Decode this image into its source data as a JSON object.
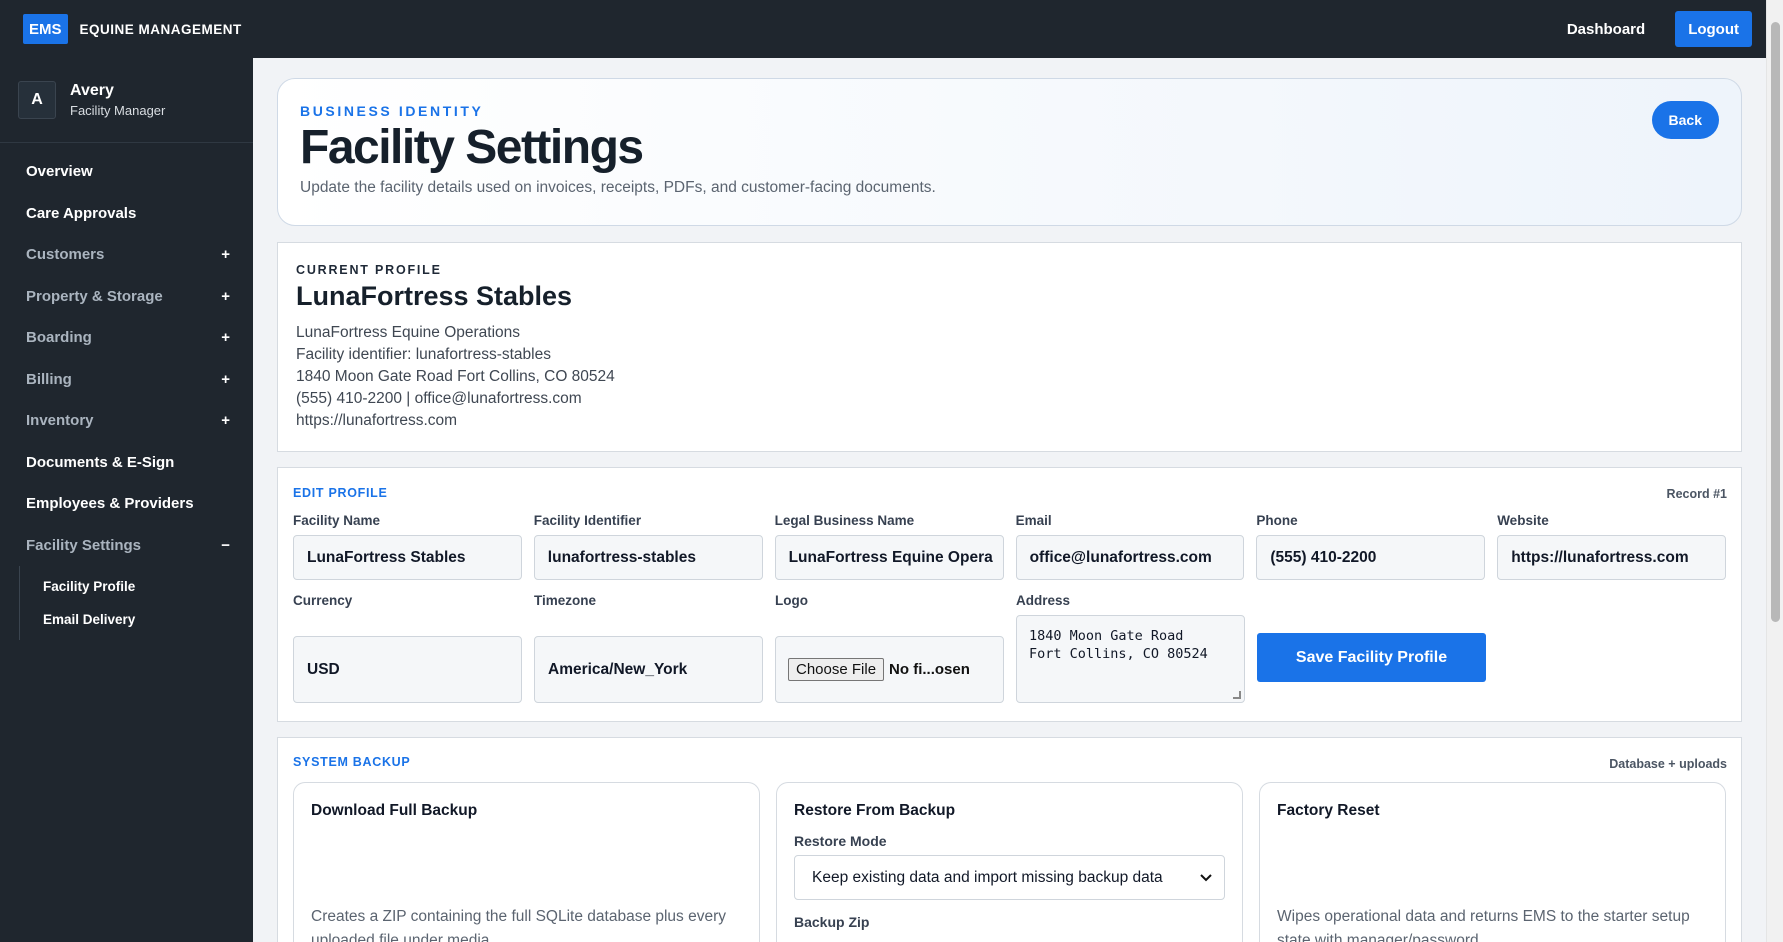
{
  "topbar": {
    "badge": "EMS",
    "brand": "EQUINE MANAGEMENT",
    "dashboard": "Dashboard",
    "logout": "Logout"
  },
  "user": {
    "initial": "A",
    "name": "Avery",
    "role": "Facility Manager"
  },
  "sidebar": {
    "items": [
      {
        "label": "Overview",
        "toggle": ""
      },
      {
        "label": "Care Approvals",
        "toggle": ""
      },
      {
        "label": "Customers",
        "toggle": "+"
      },
      {
        "label": "Property & Storage",
        "toggle": "+"
      },
      {
        "label": "Boarding",
        "toggle": "+"
      },
      {
        "label": "Billing",
        "toggle": "+"
      },
      {
        "label": "Inventory",
        "toggle": "+"
      },
      {
        "label": "Documents & E-Sign",
        "toggle": ""
      },
      {
        "label": "Employees & Providers",
        "toggle": ""
      },
      {
        "label": "Facility Settings",
        "toggle": "−"
      }
    ],
    "sub_items": [
      "Facility Profile",
      "Email Delivery"
    ]
  },
  "hero": {
    "eyebrow": "BUSINESS IDENTITY",
    "title": "Facility Settings",
    "subtitle": "Update the facility details used on invoices, receipts, PDFs, and customer-facing documents.",
    "back": "Back"
  },
  "current_profile": {
    "eyebrow": "CURRENT PROFILE",
    "name": "LunaFortress Stables",
    "legal": "LunaFortress Equine Operations",
    "identifier": "Facility identifier: lunafortress-stables",
    "address": "1840 Moon Gate Road Fort Collins, CO 80524",
    "contact": "(555) 410-2200 | office@lunafortress.com",
    "website": "https://lunafortress.com"
  },
  "edit_profile": {
    "label": "EDIT PROFILE",
    "record": "Record #1",
    "fields": {
      "facility_name": {
        "label": "Facility Name",
        "value": "LunaFortress Stables"
      },
      "facility_identifier": {
        "label": "Facility Identifier",
        "value": "lunafortress-stables"
      },
      "legal_name": {
        "label": "Legal Business Name",
        "value": "LunaFortress Equine Opera"
      },
      "email": {
        "label": "Email",
        "value": "office@lunafortress.com"
      },
      "phone": {
        "label": "Phone",
        "value": "(555) 410-2200"
      },
      "website": {
        "label": "Website",
        "value": "https://lunafortress.com"
      },
      "currency": {
        "label": "Currency",
        "value": "USD"
      },
      "timezone": {
        "label": "Timezone",
        "value": "America/New_York"
      },
      "logo": {
        "label": "Logo",
        "button": "Choose File",
        "file": "No fi...osen"
      },
      "address": {
        "label": "Address",
        "value": "1840 Moon Gate Road\nFort Collins, CO 80524"
      }
    },
    "save": "Save Facility Profile"
  },
  "system_backup": {
    "label": "SYSTEM BACKUP",
    "right": "Database + uploads",
    "download": {
      "title": "Download Full Backup",
      "desc": "Creates a ZIP containing the full SQLite database plus every uploaded file under media."
    },
    "restore": {
      "title": "Restore From Backup",
      "mode_label": "Restore Mode",
      "mode_value": "Keep existing data and import missing backup data",
      "zip_label": "Backup Zip"
    },
    "reset": {
      "title": "Factory Reset",
      "desc": "Wipes operational data and returns EMS to the starter setup state with manager/password."
    }
  }
}
